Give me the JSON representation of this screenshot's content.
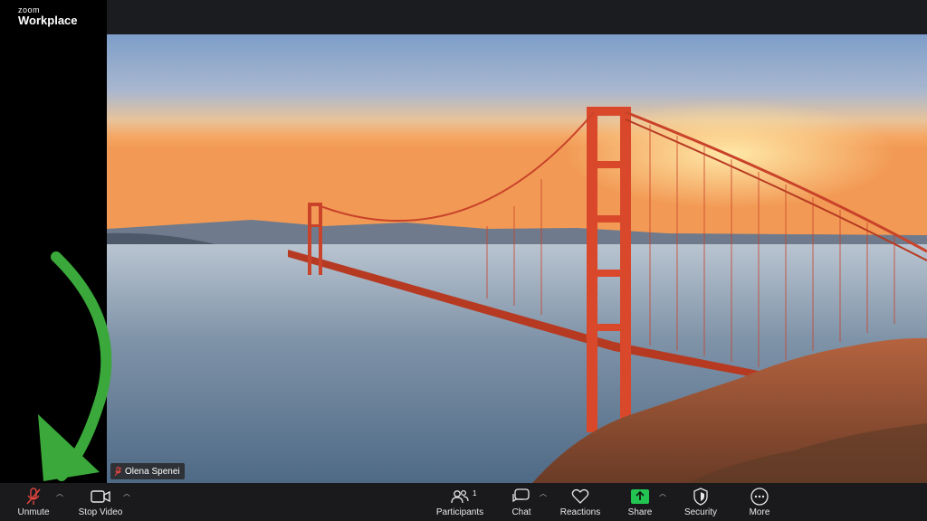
{
  "app": {
    "brand_small": "zoom",
    "brand_big": "Workplace"
  },
  "participant": {
    "name": "Olena Spenei",
    "muted": true
  },
  "toolbar": {
    "unmute_label": "Unmute",
    "stop_video_label": "Stop Video",
    "participants_label": "Participants",
    "participants_count": "1",
    "chat_label": "Chat",
    "reactions_label": "Reactions",
    "share_label": "Share",
    "security_label": "Security",
    "more_label": "More"
  },
  "colors": {
    "share_green": "#23c552",
    "muted_red": "#e0443e",
    "arrow_green": "#3aa83a",
    "bridge": "#d9482b"
  }
}
